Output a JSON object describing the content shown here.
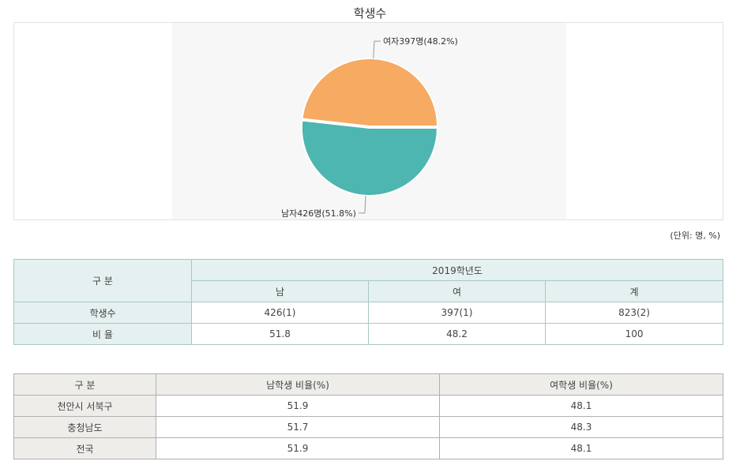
{
  "chart_data": {
    "type": "pie",
    "title": "학생수",
    "slices": [
      {
        "label": "여자397명(48.2%)",
        "category": "여자",
        "value": 397,
        "percent": 48.2,
        "color": "#f6aa62"
      },
      {
        "label": "남자426명(51.8%)",
        "category": "남자",
        "value": 426,
        "percent": 51.8,
        "color": "#4db6b0"
      }
    ]
  },
  "unit_note": "(단위: 명, %)",
  "table1": {
    "header_group": "구 분",
    "year_header": "2019학년도",
    "columns": [
      "남",
      "여",
      "계"
    ],
    "rows": [
      {
        "label": "학생수",
        "values": [
          "426(1)",
          "397(1)",
          "823(2)"
        ]
      },
      {
        "label": "비 율",
        "values": [
          "51.8",
          "48.2",
          "100"
        ]
      }
    ]
  },
  "table2": {
    "headers": [
      "구 분",
      "남학생 비율(%)",
      "여학생 비율(%)"
    ],
    "rows": [
      {
        "label": "천안시 서북구",
        "values": [
          "51.9",
          "48.1"
        ]
      },
      {
        "label": "충청남도",
        "values": [
          "51.7",
          "48.3"
        ]
      },
      {
        "label": "전국",
        "values": [
          "51.9",
          "48.1"
        ]
      }
    ]
  }
}
